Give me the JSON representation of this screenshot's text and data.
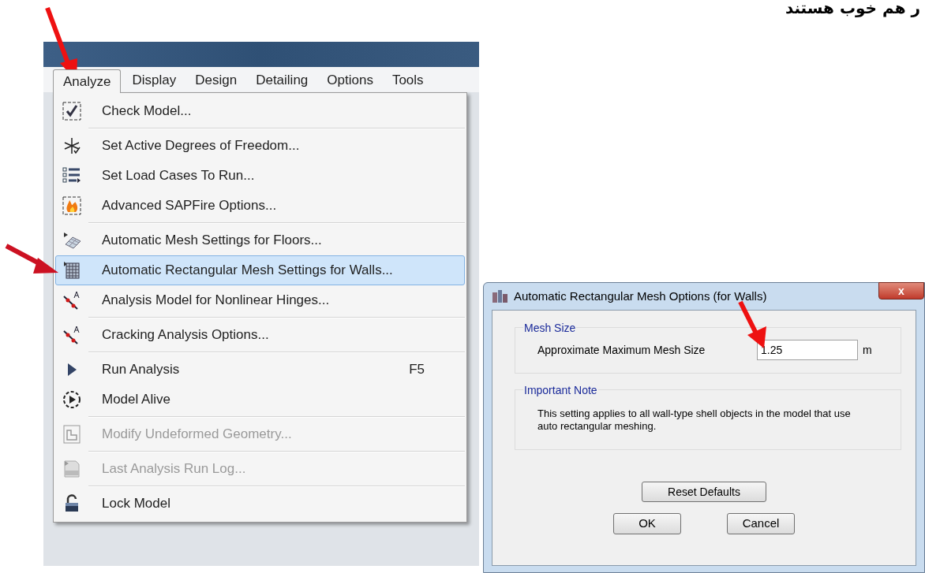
{
  "caption": "ر هم خوب هستند",
  "menu_bar": [
    {
      "label": "Analyze",
      "selected": true
    },
    {
      "label": "Display",
      "selected": false
    },
    {
      "label": "Design",
      "selected": false
    },
    {
      "label": "Detailing",
      "selected": false
    },
    {
      "label": "Options",
      "selected": false
    },
    {
      "label": "Tools",
      "selected": false
    }
  ],
  "menu": [
    {
      "kind": "item",
      "label": "Check Model...",
      "selected": false,
      "disabled": false
    },
    {
      "kind": "separator"
    },
    {
      "kind": "item",
      "label": "Set Active Degrees of Freedom...",
      "selected": false,
      "disabled": false
    },
    {
      "kind": "item",
      "label": "Set Load Cases To Run...",
      "selected": false,
      "disabled": false
    },
    {
      "kind": "item",
      "label": "Advanced SAPFire Options...",
      "selected": false,
      "disabled": false
    },
    {
      "kind": "separator"
    },
    {
      "kind": "item",
      "label": "Automatic Mesh Settings for Floors...",
      "selected": false,
      "disabled": false
    },
    {
      "kind": "item",
      "label": "Automatic Rectangular Mesh Settings for Walls...",
      "selected": true,
      "disabled": false
    },
    {
      "kind": "item",
      "label": "Analysis Model for Nonlinear Hinges...",
      "selected": false,
      "disabled": false
    },
    {
      "kind": "separator"
    },
    {
      "kind": "item",
      "label": "Cracking Analysis Options...",
      "selected": false,
      "disabled": false
    },
    {
      "kind": "separator"
    },
    {
      "kind": "item",
      "label": "Run Analysis",
      "shortcut": "F5",
      "selected": false,
      "disabled": false
    },
    {
      "kind": "item",
      "label": "Model Alive",
      "selected": false,
      "disabled": false
    },
    {
      "kind": "separator"
    },
    {
      "kind": "item",
      "label": "Modify Undeformed Geometry...",
      "selected": false,
      "disabled": true
    },
    {
      "kind": "separator"
    },
    {
      "kind": "item",
      "label": "Last Analysis Run Log...",
      "selected": false,
      "disabled": true
    },
    {
      "kind": "separator"
    },
    {
      "kind": "item",
      "label": "Lock Model",
      "selected": false,
      "disabled": false
    }
  ],
  "dialog": {
    "title": "Automatic Rectangular Mesh Options (for Walls)",
    "close": "x",
    "mesh_group": {
      "heading": "Mesh Size",
      "label": "Approximate Maximum Mesh Size",
      "value": "1.25",
      "unit": "m"
    },
    "note_group": {
      "heading": "Important Note",
      "text": "This setting applies to all wall-type shell objects in the model that use auto rectangular meshing."
    },
    "reset_button": "Reset Defaults",
    "buttons": [
      "OK",
      "Cancel"
    ]
  }
}
